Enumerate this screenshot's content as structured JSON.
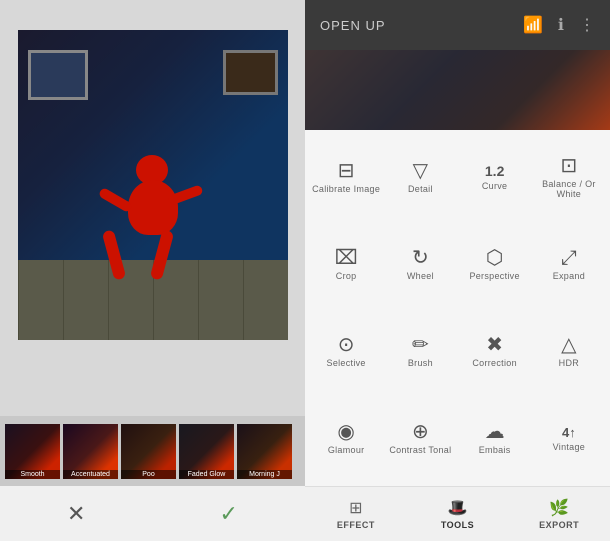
{
  "left_panel": {
    "thumbnails": [
      {
        "label": "Smooth"
      },
      {
        "label": "Accentuated"
      },
      {
        "label": "Poo"
      },
      {
        "label": "Faded Glow"
      },
      {
        "label": "Morning J"
      }
    ],
    "cancel_label": "✕",
    "confirm_label": "✓"
  },
  "right_panel": {
    "header": {
      "title": "OPEN UP",
      "icons": [
        "wifi",
        "info",
        "more"
      ]
    },
    "tools": [
      {
        "icon": "⊟",
        "label": "Calibrate Image"
      },
      {
        "icon": "▽",
        "label": "Detail"
      },
      {
        "icon": "12.",
        "label": "Curve"
      },
      {
        "icon": "⊡",
        "label": "Balance / Or White"
      },
      {
        "icon": "⌧",
        "label": "Crop"
      },
      {
        "icon": "⟳",
        "label": "Wheel"
      },
      {
        "icon": "⬡",
        "label": "Perspective"
      },
      {
        "icon": "⌕",
        "label": "Expand"
      },
      {
        "icon": "⊙",
        "label": "Selective"
      },
      {
        "icon": "✏",
        "label": "Brush"
      },
      {
        "icon": "✖",
        "label": "Correction"
      },
      {
        "icon": "△",
        "label": "HDR"
      },
      {
        "icon": "👁",
        "label": "Glamour"
      },
      {
        "icon": "⊕",
        "label": "Contrast Tonal"
      },
      {
        "icon": "☁",
        "label": "Embais"
      },
      {
        "icon": "4↑",
        "label": "Vintage"
      }
    ],
    "bottom_nav": [
      {
        "icon": "⊞",
        "label": "EFFECT"
      },
      {
        "icon": "🎩",
        "label": "TOOLS"
      },
      {
        "icon": "🌿",
        "label": "EXPORT"
      }
    ]
  }
}
